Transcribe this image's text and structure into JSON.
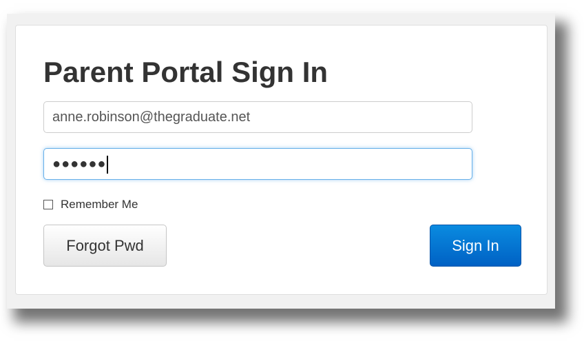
{
  "login": {
    "title": "Parent Portal Sign In",
    "email_value": "anne.robinson@thegraduate.net",
    "password_masked": "●●●●●●",
    "remember_label": "Remember Me",
    "remember_checked": false,
    "forgot_label": "Forgot Pwd",
    "signin_label": "Sign In"
  },
  "colors": {
    "accent": "#0070d2",
    "title_text": "#333333",
    "focus_border": "#66afe9"
  }
}
